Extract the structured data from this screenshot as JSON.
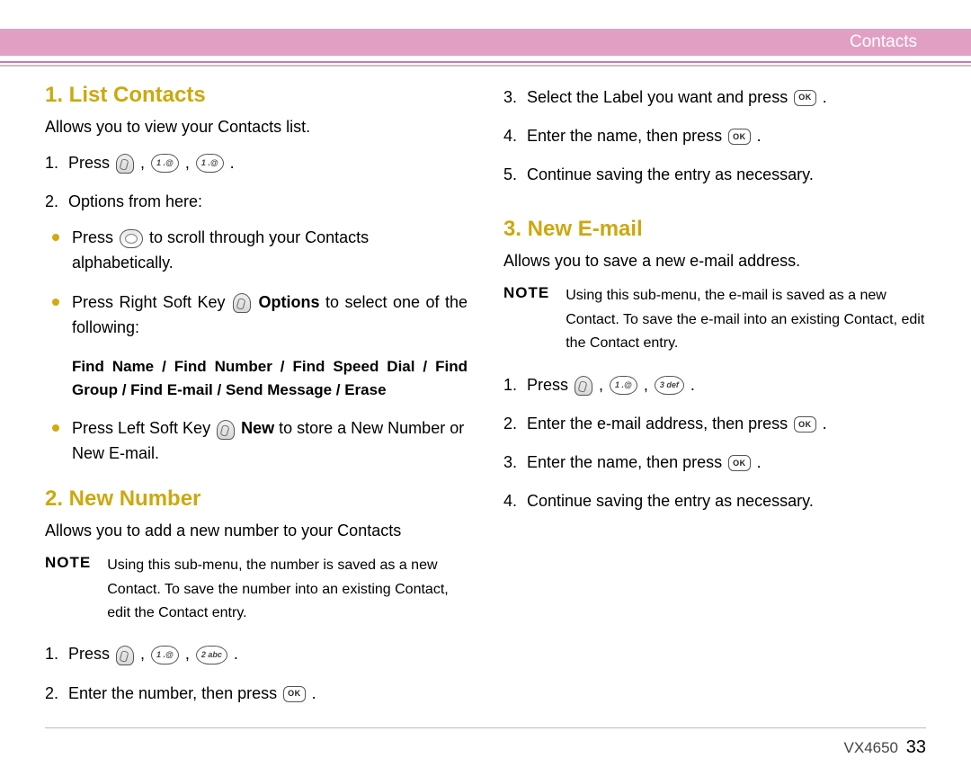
{
  "header": {
    "title": "Contacts"
  },
  "left": {
    "s1": {
      "heading": "1. List Contacts",
      "intro": "Allows you to view your Contacts list.",
      "step1_pre": "Press ",
      "step2": "Options from here:",
      "b1_pre": "Press ",
      "b1_post": " to scroll through your Contacts alphabetically.",
      "b2_pre": "Press Right Soft Key ",
      "b2_bold": " Options",
      "b2_post": " to select one of the following:",
      "subbold": "Find Name / Find Number / Find Speed Dial / Find Group / Find E-mail / Send Message / Erase",
      "b3_pre": "Press Left Soft Key ",
      "b3_bold": " New",
      "b3_post": " to store a New Number or New E-mail."
    },
    "s2": {
      "heading": "2. New Number",
      "intro": "Allows you to add a new number to your Contacts",
      "note_label": "NOTE",
      "note_text": "Using this sub-menu, the number is saved as a new Contact. To save the number into an existing Contact, edit the Contact entry.",
      "step1_pre": "Press ",
      "step2_pre": "Enter the number, then press "
    }
  },
  "right": {
    "r3_pre": "Select the Label you want and press ",
    "r4_pre": "Enter the name, then press ",
    "r5": "Continue saving the entry as necessary.",
    "s3": {
      "heading": "3. New E-mail",
      "intro": "Allows you to save a new e-mail address.",
      "note_label": "NOTE",
      "note_text": "Using this sub-menu, the e-mail is saved as a new Contact. To save the e-mail into an existing Contact, edit the Contact entry.",
      "step1_pre": "Press ",
      "step2_pre": "Enter the e-mail address, then press ",
      "step3_pre": "Enter the name, then press ",
      "step4": "Continue saving the entry as necessary."
    }
  },
  "keys": {
    "one": "1 .@",
    "two": "2 abc",
    "three": "3 def",
    "ok": "OK"
  },
  "footer": {
    "model": "VX4650",
    "page": "33"
  }
}
